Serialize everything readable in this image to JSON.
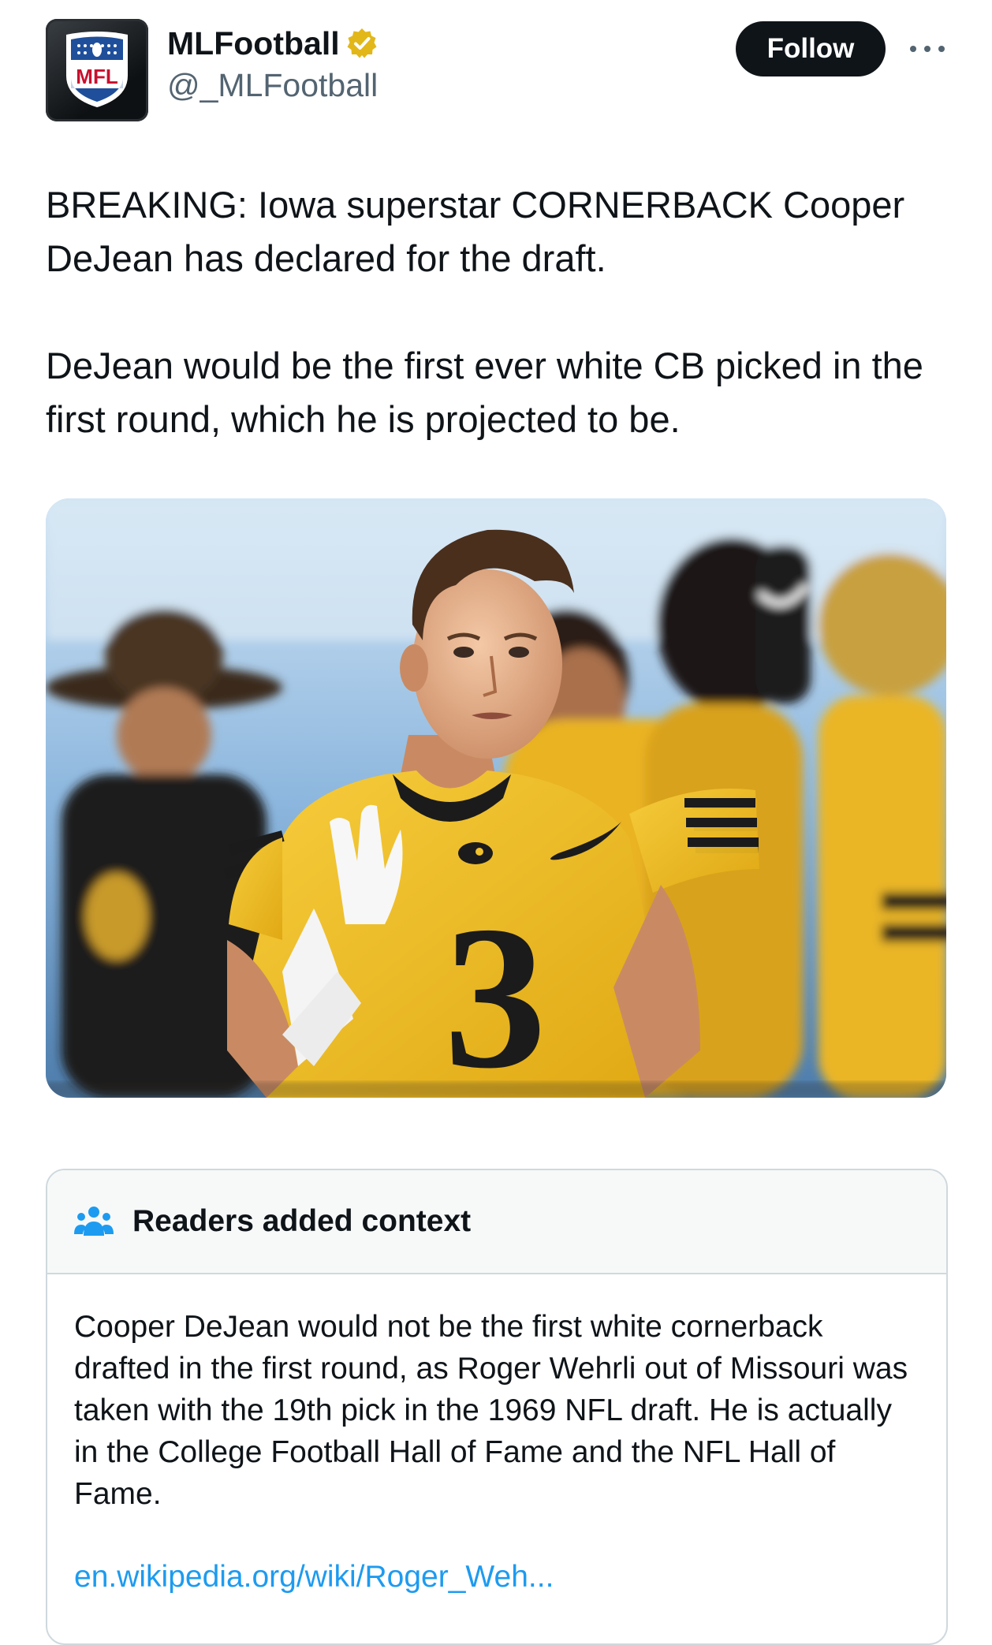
{
  "author": {
    "display_name": "MLFootball",
    "handle": "@_MLFootball",
    "verified": true,
    "avatar_text": "MFL"
  },
  "actions": {
    "follow_label": "Follow",
    "more_icon": "more-dots-icon"
  },
  "tweet": {
    "paragraphs": [
      "BREAKING: Iowa superstar CORNERBACK Cooper DeJean has declared for the draft.",
      "DeJean would be the first ever white CB picked in the first round, which he is projected to be."
    ]
  },
  "media": {
    "jersey_number": "3"
  },
  "community_note": {
    "title": "Readers added context",
    "icon": "people-icon",
    "body": "Cooper DeJean would not be the first white cornerback drafted in the first round, as Roger Wehrli out of Missouri was taken with the 19th pick in the 1969 NFL draft. He is actually in the College Football Hall of Fame and the NFL Hall of Fame.",
    "link_text": "en.wikipedia.org/wiki/Roger_Weh..."
  },
  "colors": {
    "text": "#0f1419",
    "secondary": "#536471",
    "link": "#1d9bf0",
    "badge_gold": "#e2b719",
    "jersey_gold": "#f2c12e",
    "border": "#cfd9de"
  }
}
